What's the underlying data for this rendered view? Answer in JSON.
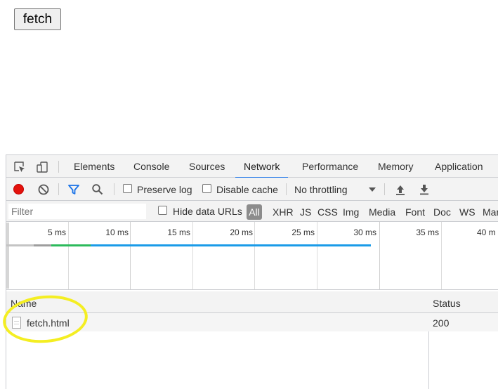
{
  "page": {
    "button_label": "fetch"
  },
  "devtools": {
    "tabs": [
      "Elements",
      "Console",
      "Sources",
      "Network",
      "Performance",
      "Memory",
      "Application"
    ],
    "active_tab": "Network",
    "toolbar": {
      "preserve_log": "Preserve log",
      "disable_cache": "Disable cache",
      "throttling": "No throttling"
    },
    "filter": {
      "placeholder": "Filter",
      "hide_data_urls": "Hide data URLs",
      "types": [
        "All",
        "XHR",
        "JS",
        "CSS",
        "Img",
        "Media",
        "Font",
        "Doc",
        "WS",
        "Mar"
      ]
    },
    "timeline": {
      "ticks": [
        "5 ms",
        "10 ms",
        "15 ms",
        "20 ms",
        "25 ms",
        "30 ms",
        "35 ms",
        "40 m"
      ]
    },
    "table": {
      "columns": [
        "Name",
        "Status"
      ],
      "rows": [
        {
          "name": "fetch.html",
          "status": "200"
        }
      ]
    }
  },
  "colors": {
    "accent": "#1a73e8",
    "record": "#e3120b",
    "annotation": "#f4ee22"
  }
}
